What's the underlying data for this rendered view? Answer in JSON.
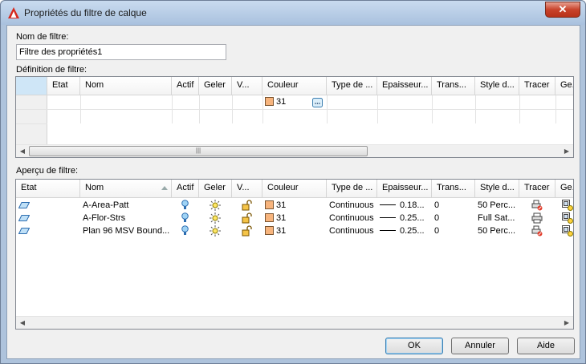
{
  "window": {
    "title": "Propriétés du filtre de calque",
    "close_label": "✕"
  },
  "filter_name": {
    "label": "Nom de filtre:",
    "value": "Filtre des propriétés1"
  },
  "definition": {
    "label": "Définition de filtre:",
    "columns": [
      "Etat",
      "Nom",
      "Actif",
      "Geler",
      "V...",
      "Couleur",
      "Type de ...",
      "Epaisseur...",
      "Trans...",
      "Style d...",
      "Tracer",
      "Ge..."
    ],
    "row": {
      "couleur": "31"
    },
    "thumb_grip": "|||"
  },
  "preview": {
    "label": "Aperçu de filtre:",
    "columns": [
      "Etat",
      "Nom",
      "Actif",
      "Geler",
      "V...",
      "Couleur",
      "Type de ...",
      "Epaisseur...",
      "Trans...",
      "Style d...",
      "Tracer",
      "Ge..."
    ],
    "rows": [
      {
        "nom": "A-Area-Patt",
        "couleur": "31",
        "type": "Continuous",
        "epaisseur": "0.18...",
        "trans": "0",
        "style": "50 Perc..."
      },
      {
        "nom": "A-Flor-Strs",
        "couleur": "31",
        "type": "Continuous",
        "epaisseur": "0.25...",
        "trans": "0",
        "style": "Full Sat..."
      },
      {
        "nom": "Plan 96 MSV Bound...",
        "couleur": "31",
        "type": "Continuous",
        "epaisseur": "0.25...",
        "trans": "0",
        "style": "50 Perc..."
      }
    ]
  },
  "buttons": {
    "ok": "OK",
    "cancel": "Annuler",
    "help": "Aide"
  },
  "colors": {
    "layer_color": "#f7b47d",
    "accent": "#3c7fb1"
  }
}
